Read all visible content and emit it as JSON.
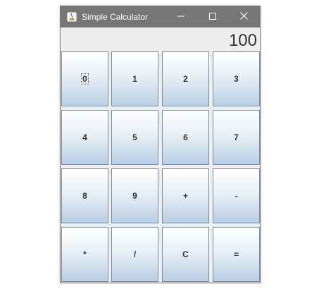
{
  "window": {
    "title": "Simple Calculator",
    "icon": "java-icon"
  },
  "display": {
    "value": "100"
  },
  "keys": [
    {
      "label": "0",
      "focused": true
    },
    {
      "label": "1"
    },
    {
      "label": "2"
    },
    {
      "label": "3"
    },
    {
      "label": "4"
    },
    {
      "label": "5"
    },
    {
      "label": "6"
    },
    {
      "label": "7"
    },
    {
      "label": "8"
    },
    {
      "label": "9"
    },
    {
      "label": "+"
    },
    {
      "label": "-"
    },
    {
      "label": "*"
    },
    {
      "label": "/"
    },
    {
      "label": "C"
    },
    {
      "label": "="
    }
  ],
  "colors": {
    "titlebar": "#767676",
    "button_top": "#ffffff",
    "button_bottom": "#b8cfe5",
    "button_border": "#7a8a99"
  }
}
